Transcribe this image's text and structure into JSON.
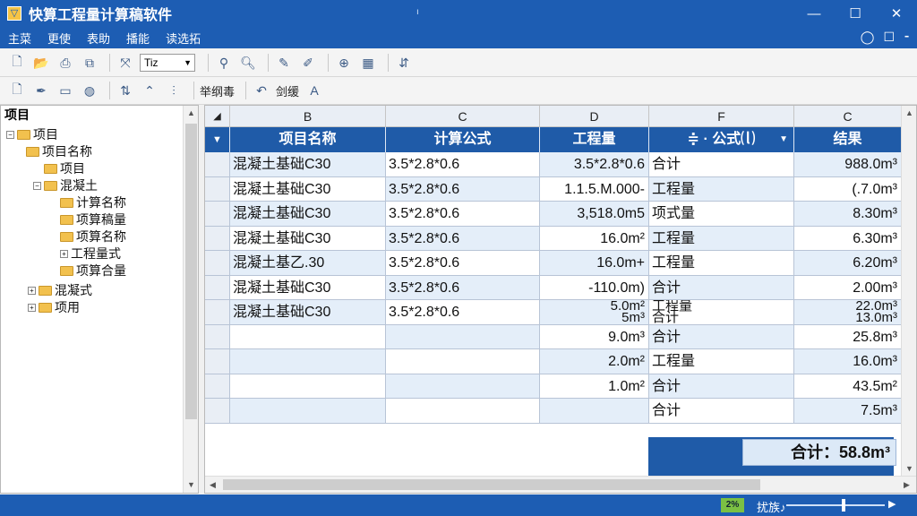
{
  "window": {
    "title": "快算工程量计算稿软件",
    "title_mid_glyph": "ı",
    "controls": {
      "minimize": "—",
      "maximize": "☐",
      "close": "✕"
    }
  },
  "menu": {
    "items": [
      "主菜",
      "更使",
      "表助",
      "播能",
      "读选拓"
    ],
    "right_icons": [
      "◯",
      "☐",
      "⁃"
    ]
  },
  "toolbar1": {
    "font_select": "Tiz",
    "icons": [
      "new-file-icon",
      "open-folder-icon",
      "print-icon",
      "copy-icon",
      "format-icon",
      "person-icon",
      "search-icon",
      "pin-icon",
      "pen-icon",
      "zoom-icon",
      "grid-icon",
      "refresh-icon"
    ]
  },
  "toolbar2": {
    "label1": "举纲毒",
    "label2": "剑缓",
    "icons": [
      "page-icon",
      "brush-icon",
      "monitor-icon",
      "globe-icon",
      "sort-icon",
      "edit-icon",
      "filter-icon",
      "undo-icon",
      "text-color-icon"
    ]
  },
  "tree": {
    "header": "项目",
    "nodes": [
      {
        "label": "项目",
        "level": 0,
        "expander": "−"
      },
      {
        "label": "项目名称",
        "level": 1,
        "expander": ""
      },
      {
        "label": "项目",
        "level": 2,
        "expander": ""
      },
      {
        "label": "混凝土",
        "level": 2,
        "expander": "−"
      },
      {
        "label": "计算名称",
        "level": 3,
        "expander": ""
      },
      {
        "label": "项算稿量",
        "level": 3,
        "expander": ""
      },
      {
        "label": "项算名称",
        "level": 3,
        "expander": ""
      },
      {
        "label": "工程量式",
        "level": 3,
        "expander": "+"
      },
      {
        "label": "项算合量",
        "level": 3,
        "expander": ""
      },
      {
        "label": "混凝式",
        "level": 2,
        "expander": "+"
      },
      {
        "label": "项用",
        "level": 2,
        "expander": "+"
      }
    ]
  },
  "grid": {
    "column_letters": [
      "B",
      "C",
      "D",
      "F",
      "C"
    ],
    "headers": [
      "项目名称",
      "计算公式",
      "工程量",
      "≑  ·  公式⒧",
      "结果"
    ],
    "rows": [
      {
        "name": "混凝土基础C30",
        "formula": "3.5*2.8*0.6",
        "quantity": "3.5*2.8*0.6",
        "type": "合计",
        "result": "988.0m³"
      },
      {
        "name": "混凝土基础C30",
        "formula": "3.5*2.8*0.6",
        "quantity": "1.1.5.M.000-",
        "type": "工程量",
        "result": "(.7.0m³"
      },
      {
        "name": "混凝土基础C30",
        "formula": "3.5*2.8*0.6",
        "quantity": "3,518.0m5",
        "type": "项式量",
        "result": "8.30m³"
      },
      {
        "name": "混凝土基础C30",
        "formula": "3.5*2.8*0.6",
        "quantity": "16.0m²",
        "type": "工程量",
        "result": "6.30m³"
      },
      {
        "name": "混凝土基乙.30",
        "formula": "3.5*2.8*0.6",
        "quantity": "16.0m+",
        "type": "工程量",
        "result": "6.20m³"
      },
      {
        "name": "混凝土基础C30",
        "formula": "3.5*2.8*0.6",
        "quantity": "-110.0m)",
        "type": "合计",
        "result": "2.00m³"
      },
      {
        "name": "混凝土基础C30",
        "formula": "3.5*2.8*0.6",
        "quantity": "5.0m² 5m³",
        "type": "工程量 合计",
        "result": "22.0m³ 13.0m³"
      },
      {
        "name": "",
        "formula": "",
        "quantity": "9.0m³",
        "type": "合计",
        "result": "25.8m³"
      },
      {
        "name": "",
        "formula": "",
        "quantity": "2.0m²",
        "type": "工程量",
        "result": "16.0m³"
      },
      {
        "name": "",
        "formula": "",
        "quantity": "1.0m²",
        "type": "合计",
        "result": "43.5m²"
      },
      {
        "name": "",
        "formula": "",
        "quantity": "",
        "type": "合计",
        "result": "7.5m³"
      },
      {
        "name": "",
        "formula": "",
        "quantity": "",
        "type": "",
        "result": ""
      }
    ],
    "total": "合计：58.8m³"
  },
  "status": {
    "badge": "2%",
    "text": "扰族♪"
  }
}
